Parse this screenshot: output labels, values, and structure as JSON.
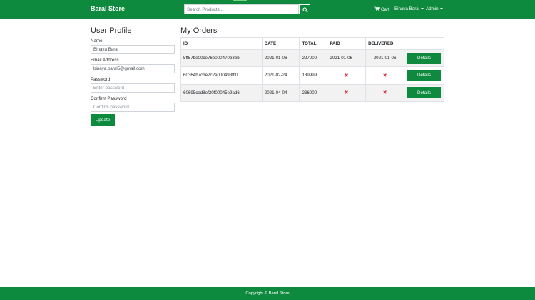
{
  "header": {
    "brand": "Baral Store",
    "search_placeholder": "Search Products...",
    "cart_label": "Cart",
    "user_label": "Binaya Baral",
    "admin_label": "Admin"
  },
  "profile": {
    "title": "User Profile",
    "name_label": "Name",
    "name_value": "Binaya Baral",
    "email_label": "Email Address",
    "email_value": "binaya.baral5@gmail.com",
    "password_label": "Password",
    "password_placeholder": "Enter password",
    "confirm_label": "Confirm Password",
    "confirm_placeholder": "Confirm password",
    "update_label": "Update"
  },
  "orders": {
    "title": "My Orders",
    "columns": [
      "ID",
      "DATE",
      "TOTAL",
      "PAID",
      "DELIVERED",
      ""
    ],
    "rows": [
      {
        "id": "5ff57be00ce76e000470b3bb",
        "date": "2021-01-06",
        "total": "227000",
        "paid": "2021-01-06",
        "delivered": "2021-01-06",
        "details_label": "Details"
      },
      {
        "id": "60364b7cbe2c2e000498fff0",
        "date": "2021-02-24",
        "total": "139999",
        "paid": "",
        "delivered": "",
        "details_label": "Details"
      },
      {
        "id": "60695ced8ef20f00045e9ad6",
        "date": "2021-04-04",
        "total": "236000",
        "paid": "",
        "delivered": "",
        "details_label": "Details"
      }
    ]
  },
  "footer": {
    "copyright": "Copyright © Baral Store"
  },
  "colors": {
    "primary": "#0e8a3e",
    "danger": "#dc3545"
  }
}
